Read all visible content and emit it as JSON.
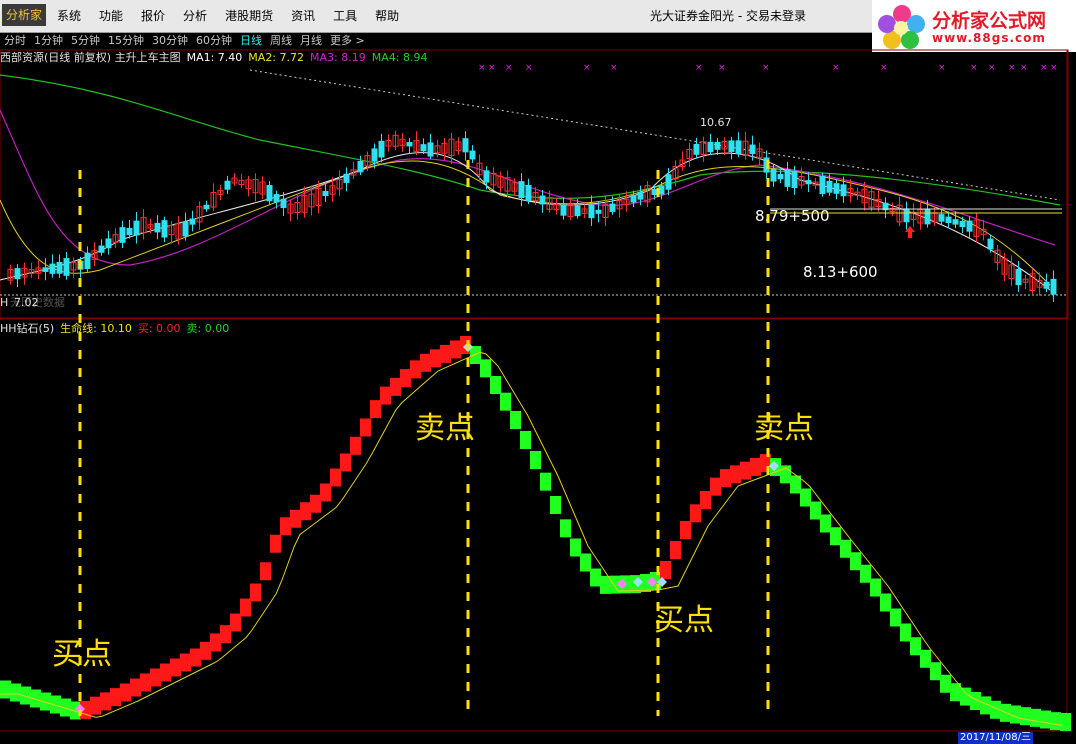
{
  "menubar": {
    "logo": "分析家",
    "items": [
      "系统",
      "功能",
      "报价",
      "分析",
      "港股期货",
      "资讯",
      "工具",
      "帮助"
    ],
    "broker": "光大证券金阳光 - 交易未登录"
  },
  "brand": {
    "name": "分析家公式网",
    "url": "www.88gs.com"
  },
  "periods": [
    "分时",
    "1分钟",
    "5分钟",
    "15分钟",
    "30分钟",
    "60分钟",
    "日线",
    "周线",
    "月线",
    "更多 >"
  ],
  "active_period": "日线",
  "main_header": {
    "title": "西部资源(日线 前复权) 主升上车主图",
    "ma1": "MA1: 7.40",
    "ma2": "MA2: 7.72",
    "ma3": "MA3: 8.19",
    "ma4": "MA4: 8.94",
    "colors": {
      "ma1": "#ffffff",
      "ma2": "#f0e020",
      "ma3": "#d020d0",
      "ma4": "#20d020"
    }
  },
  "price_labels": {
    "high": "10.67",
    "low": "7.02",
    "low_prefix": "H",
    "note": "无历史数据"
  },
  "annotations": {
    "target1": "8.79+500",
    "target2": "8.13+600"
  },
  "sub_header": {
    "title": "HH钻石(5)",
    "life": "生命线: 10.10",
    "buy": "买: 0.00",
    "sell": "卖: 0.00"
  },
  "signals": {
    "buy": "买点",
    "sell": "卖点"
  },
  "status": {
    "date": "2017/11/08/三"
  },
  "colors": {
    "up": "#ff2020",
    "down": "#20ff20",
    "signal": "#ffe000",
    "bg": "#000000"
  }
}
